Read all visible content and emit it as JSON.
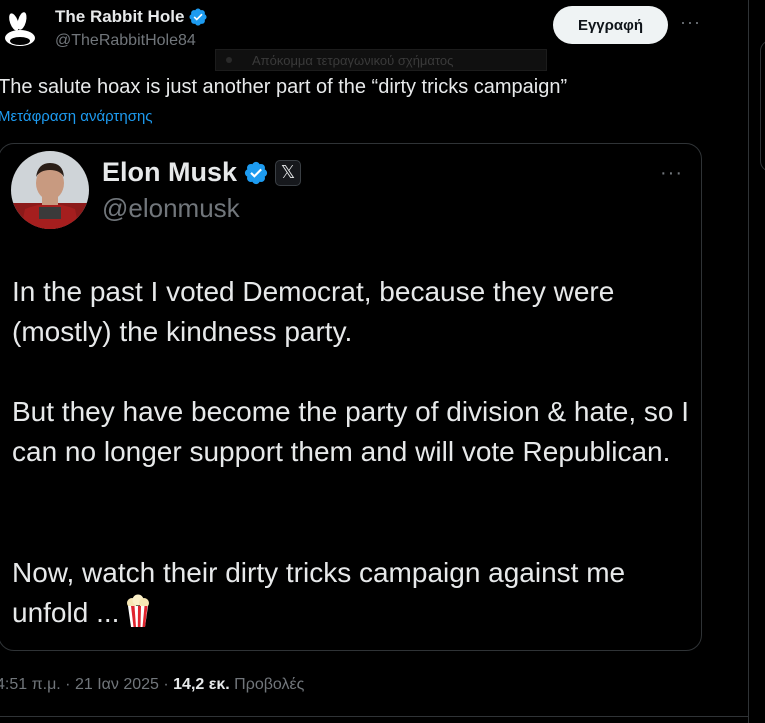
{
  "author": {
    "name": "The Rabbit Hole",
    "handle": "@TheRabbitHole84"
  },
  "header": {
    "subscribe_label": "Εγγραφή",
    "more_label": "···"
  },
  "tooltip": {
    "text": "Απόκομμα τετραγωνικού σχήματος"
  },
  "post": {
    "text": "The salute hoax is just another part of the “dirty tricks campaign”",
    "translate_label": "Μετάφραση ανάρτησης"
  },
  "quote": {
    "name": "Elon Musk",
    "handle": "@elonmusk",
    "x_badge": "𝕏",
    "more_label": "···",
    "paragraphs": [
      "In the past I voted Democrat, because they were (mostly) the kindness party.",
      "But they have become the party of division & hate, so I can no longer support them and will vote Republican.",
      "Now, watch their dirty tricks campaign against me unfold ..."
    ],
    "emoji_icon": "popcorn-icon"
  },
  "meta": {
    "time": "4:51 π.μ.",
    "separator": " · ",
    "date": "21 Ιαν 2025",
    "views_count": "14,2 εκ.",
    "views_label": "Προβολές"
  },
  "colors": {
    "background": "#000000",
    "text": "#e7e9ea",
    "muted": "#71767b",
    "link": "#1d9bf0",
    "verified": "#1d9bf0",
    "border": "#2f3336",
    "button_bg": "#eff3f4"
  }
}
